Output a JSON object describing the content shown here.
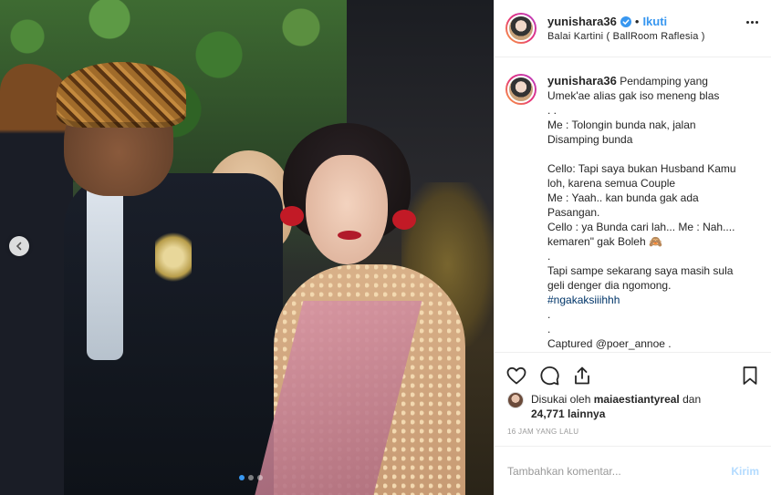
{
  "post": {
    "carousel": {
      "slide_count": 3,
      "active_index": 0
    }
  },
  "header": {
    "username": "yunishara36",
    "separator": "•",
    "follow_label": "Ikuti",
    "location": "Balai Kartini ( BallRoom Raflesia )",
    "verified_icon": "verified-badge-icon",
    "more_icon": "more-options-icon"
  },
  "caption": {
    "username": "yunishara36",
    "lines": [
      "Pendamping yang",
      "Umek'ae alias gak iso meneng blas",
      ". .",
      "Me : Tolongin bunda nak, jalan",
      "Disamping bunda",
      "",
      "Cello: Tapi saya bukan Husband Kamu",
      "loh, karena semua Couple",
      "Me : Yaah.. kan bunda gak ada",
      "Pasangan.",
      "Cello : ya Bunda cari lah... Me : Nah....",
      "kemaren\" gak Boleh 🙈",
      ".",
      "Tapi sampe sekarang saya masih sula",
      "geli denger dia ngomong.",
      "#ngakaksiiihhh",
      ".",
      ".",
      "Captured @poer_annoe ."
    ]
  },
  "actions": {
    "like_icon": "heart-icon",
    "comment_icon": "comment-icon",
    "share_icon": "share-icon",
    "save_icon": "bookmark-icon"
  },
  "likes": {
    "prefix": "Disukai oleh ",
    "user": "maiaestiantyreal",
    "middle": " dan",
    "count": "24,771 lainnya"
  },
  "timestamp": "16 JAM YANG LALU",
  "comment_box": {
    "placeholder": "Tambahkan komentar...",
    "post_label": "Kirim"
  },
  "colors": {
    "accent": "#3897f0",
    "post_disabled": "#b3dbff",
    "text": "#262626",
    "muted": "#999999"
  }
}
